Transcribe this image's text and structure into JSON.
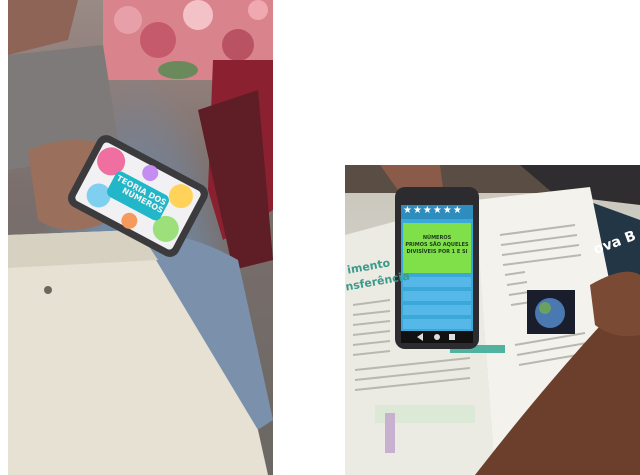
{
  "left_photo": {
    "phone_screen": {
      "title_line1": "TEORIA DOS",
      "title_line2": "NÚMEROS"
    }
  },
  "right_photo": {
    "phone_screen": {
      "stars": "★★★★★★",
      "question_line1": "NÚMEROS",
      "question_line2": "PRIMOS SÃO AQUELES",
      "question_line3": "DIVISÍVEIS POR 1 E SI"
    },
    "book": {
      "heading_line1": "imento",
      "heading_line2": "nsferência",
      "cover_text": "ova B"
    }
  }
}
